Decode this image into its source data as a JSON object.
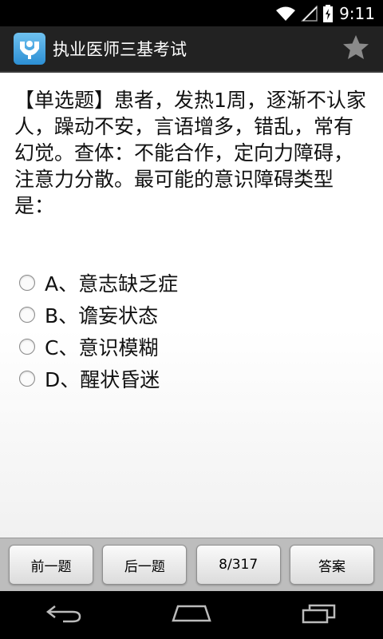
{
  "status_bar": {
    "time": "9:11"
  },
  "app": {
    "title": "执业医师三基考试"
  },
  "question": {
    "text": "【单选题】患者，发热1周，逐渐不认家人，躁动不安，言语增多，错乱，常有幻觉。查体：不能合作，定向力障碍，注意力分散。最可能的意识障碍类型是："
  },
  "options": [
    {
      "label": "A、意志缺乏症"
    },
    {
      "label": "B、谵妄状态"
    },
    {
      "label": "C、意识模糊"
    },
    {
      "label": "D、醒状昏迷"
    }
  ],
  "toolbar": {
    "prev_label": "前一题",
    "next_label": "后一题",
    "progress_label": "8/317",
    "answer_label": "答案"
  },
  "icons": {
    "wifi": "wifi-icon",
    "signal": "signal-icon",
    "battery": "battery-icon",
    "star": "star-icon",
    "back": "back-icon",
    "home": "home-icon",
    "recents": "recents-icon"
  },
  "colors": {
    "action_bar": "#222222",
    "toolbar": "#bdbdbd",
    "logo": "#2c8fd4"
  }
}
